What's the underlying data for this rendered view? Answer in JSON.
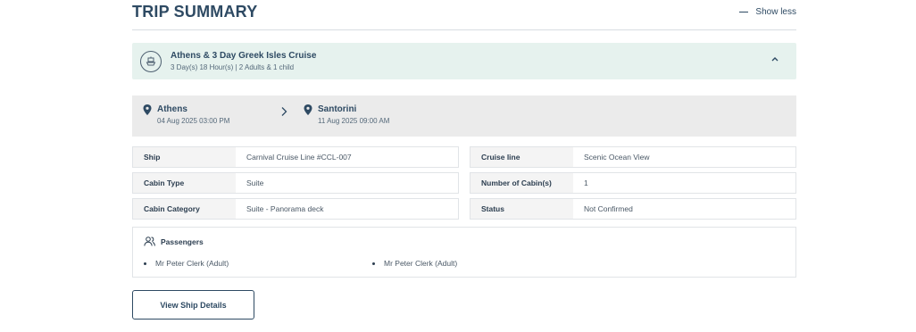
{
  "header": {
    "title": "TRIP SUMMARY",
    "toggle_label": "Show less"
  },
  "cruise": {
    "name": "Athens & 3 Day Greek Isles Cruise",
    "subtitle": "3 Day(s) 18 Hour(s) | 2 Adults & 1 child"
  },
  "route": {
    "from": {
      "city": "Athens",
      "datetime": "04 Aug 2025 03:00 PM"
    },
    "to": {
      "city": "Santorini",
      "datetime": "11 Aug 2025 09:00 AM"
    }
  },
  "details": [
    {
      "left_key": "Ship",
      "left_val": "Carnival Cruise Line #CCL-007",
      "right_key": "Cruise line",
      "right_val": "Scenic Ocean View"
    },
    {
      "left_key": "Cabin Type",
      "left_val": "Suite",
      "right_key": "Number of Cabin(s)",
      "right_val": "1"
    },
    {
      "left_key": "Cabin Category",
      "left_val": "Suite - Panorama deck",
      "right_key": "Status",
      "right_val": "Not Confirmed"
    }
  ],
  "passengers": {
    "heading": "Passengers",
    "list": [
      "Mr Peter Clerk (Adult)",
      "Mr Peter Clerk (Adult)"
    ]
  },
  "actions": {
    "view_ship": "View Ship Details"
  },
  "icons": {
    "ship": "ship-icon",
    "pin": "location-pin-icon",
    "chevron": "chevron-up-icon",
    "arrow": "chevron-right-icon",
    "people": "people-icon"
  },
  "colors": {
    "accent": "#2e4a63",
    "cruise_bg": "#e6f2ee",
    "route_bg": "#ebebeb"
  }
}
